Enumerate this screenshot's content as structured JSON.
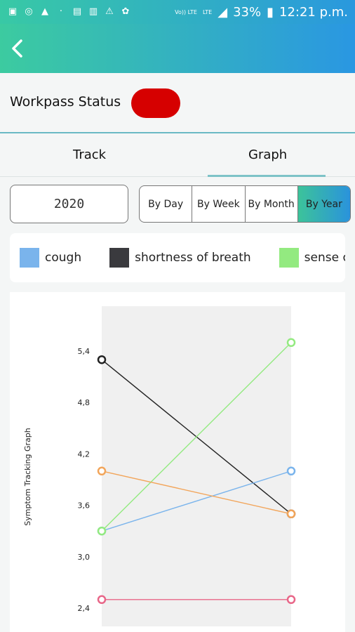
{
  "status_bar": {
    "battery": "33%",
    "time": "12:21 p.m.",
    "network_1": "Vo)) LTE",
    "network_2": "LTE"
  },
  "workpass": {
    "label": "Workpass Status",
    "status_color": "#d60000"
  },
  "tabs": [
    {
      "label": "Track",
      "active": false
    },
    {
      "label": "Graph",
      "active": true
    }
  ],
  "year_selector": {
    "value": "2020"
  },
  "period_options": [
    {
      "label": "By Day",
      "active": false
    },
    {
      "label": "By Week",
      "active": false
    },
    {
      "label": "By Month",
      "active": false
    },
    {
      "label": "By Year",
      "active": true
    }
  ],
  "legend": [
    {
      "label": "cough",
      "color": "#7ab4ec"
    },
    {
      "label": "shortness of breath",
      "color": "#3a3a3e"
    },
    {
      "label": "sense o",
      "color": "#93ea80"
    }
  ],
  "chart_data": {
    "type": "line",
    "ylabel": "Symptom Tracking Graph",
    "y_ticks": [
      "5,4",
      "4,8",
      "4,2",
      "3,6",
      "3,0",
      "2,4"
    ],
    "ylim": [
      2.4,
      5.5
    ],
    "x": [
      0,
      1
    ],
    "grid": false,
    "series": [
      {
        "name": "shortness of breath",
        "color": "#222222",
        "values": [
          5.3,
          3.5
        ]
      },
      {
        "name": "cough",
        "color": "#7ab4ec",
        "values": [
          3.3,
          4.0
        ]
      },
      {
        "name": "sense o",
        "color": "#93ea80",
        "values": [
          3.3,
          5.5
        ]
      },
      {
        "color": "#f2a55a",
        "values": [
          4.0,
          3.5
        ]
      },
      {
        "color": "#e86688",
        "values": [
          2.5,
          2.5
        ]
      }
    ]
  }
}
